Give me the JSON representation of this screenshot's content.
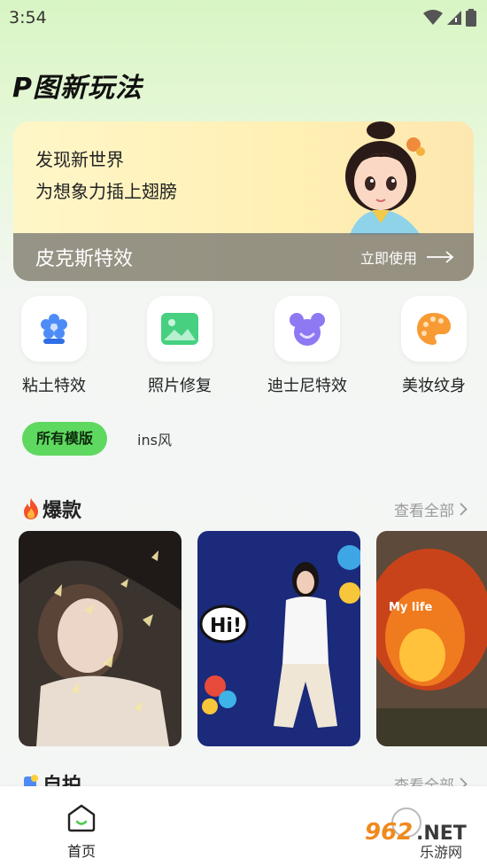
{
  "status_bar": {
    "time": "3:54"
  },
  "page_title": "P图新玩法",
  "banner": {
    "line1": "发现新世界",
    "line2": "为想象力插上翅膀",
    "effect_name": "皮克斯特效",
    "cta_label": "立即使用"
  },
  "quick_actions": [
    {
      "label": "粘土特效",
      "icon": "flower-icon",
      "color": "#3f7cf4"
    },
    {
      "label": "照片修复",
      "icon": "image-icon",
      "color": "#3fcf78"
    },
    {
      "label": "迪士尼特效",
      "icon": "mouse-ears-icon",
      "color": "#8a6ff2"
    },
    {
      "label": "美妆纹身",
      "icon": "palette-icon",
      "color": "#f79a32"
    }
  ],
  "filters": {
    "active": "所有模版",
    "other": "ins风"
  },
  "sections": [
    {
      "title": "爆款",
      "see_all": "查看全部"
    },
    {
      "title": "自拍",
      "see_all": "查看全部"
    }
  ],
  "cards": [
    {
      "caption": ""
    },
    {
      "caption": "Hi!"
    },
    {
      "caption": "My life"
    }
  ],
  "bottom_nav": {
    "home_label": "首页"
  },
  "watermark": {
    "text1": "962",
    "text2": ".NET",
    "text3": "乐游网"
  }
}
